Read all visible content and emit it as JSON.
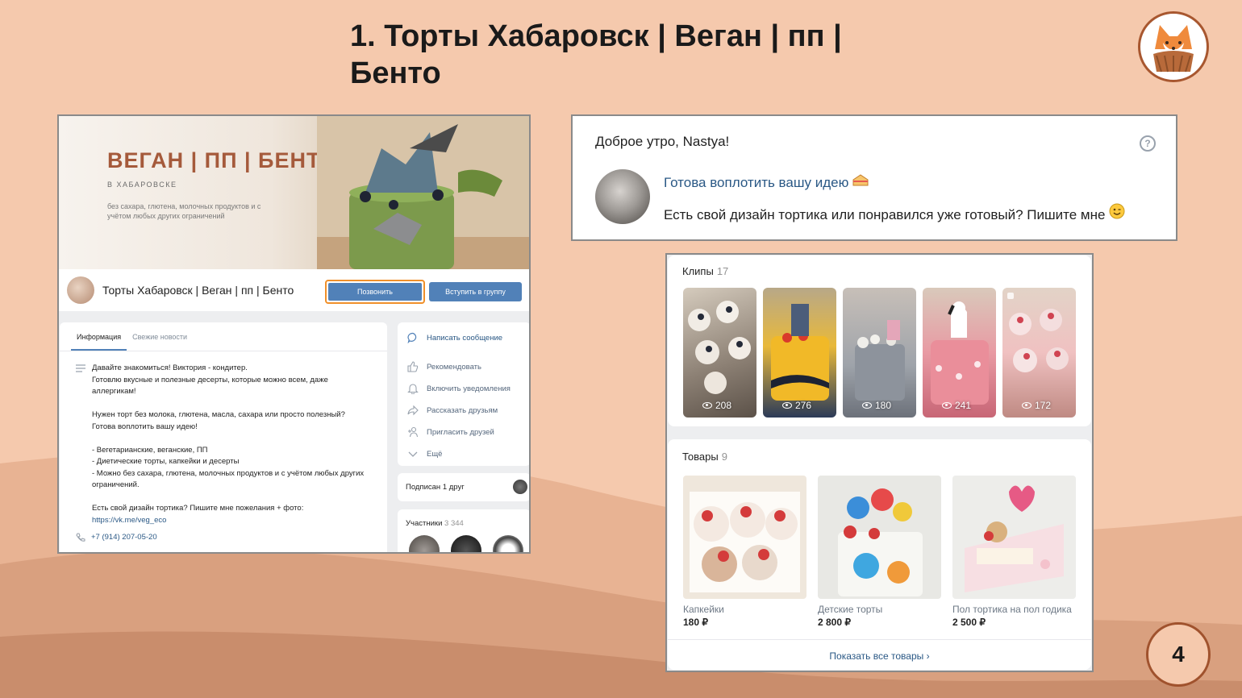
{
  "slide": {
    "title": "1. Торты Хабаровск | Веган | пп | Бенто",
    "page_number": "4"
  },
  "group_page": {
    "cover": {
      "title": "ВЕГАН | ПП | БЕНТО",
      "subtitle": "В ХАБАРОВСКЕ",
      "description": "без сахара, глютена, молочных продуктов и с учётом любых других ограничений"
    },
    "name": "Торты Хабаровск | Веган | пп | Бенто",
    "call_button": "Позвонить",
    "join_button": "Вступить в группу",
    "tabs": [
      "Информация",
      "Свежие новости"
    ],
    "info_text": "Давайте знакомиться! Виктория - кондитер.\nГотовлю вкусные и полезные десерты, которые можно всем, даже аллергикам!\n\nНужен торт без молока, глютена, масла, сахара или просто полезный?\nГотова воплотить вашу идею!\n\n- Вегетарианские, веганские, ПП\n- Диетические торты, капкейки и десерты\n- Можно без сахара, глютена, молочных продуктов и с учётом любых других ограничений.\n\nЕсть свой дизайн тортика? Пишите мне пожелания + фото:",
    "info_link": "https://vk.me/veg_eco",
    "phone": "+7 (914) 207-05-20",
    "actions": {
      "message": "Написать сообщение",
      "recommend": "Рекомендовать",
      "notify": "Включить уведомления",
      "share": "Рассказать друзьям",
      "invite": "Пригласить друзей",
      "more": "Ещё"
    },
    "subscribed": "Подписан 1 друг",
    "members_label": "Участники",
    "members_count": "3 344"
  },
  "greeting": {
    "text": "Доброе утро, Nastya!",
    "help": "?",
    "post_link": "Готова воплотить вашу идею",
    "post_text": "Есть свой дизайн тортика или понравился уже готовый? Пишите мне"
  },
  "clips": {
    "title": "Клипы",
    "count": "17",
    "items": [
      {
        "views": "208"
      },
      {
        "views": "276"
      },
      {
        "views": "180"
      },
      {
        "views": "241"
      },
      {
        "views": "172"
      }
    ]
  },
  "goods": {
    "title": "Товары",
    "count": "9",
    "items": [
      {
        "name": "Капкейки",
        "price": "180 ₽"
      },
      {
        "name": "Детские торты",
        "price": "2 800 ₽"
      },
      {
        "name": "Пол тортика на пол годика",
        "price": "2 500 ₽"
      }
    ],
    "show_all": "Показать все товары ›"
  },
  "colors": {
    "background": "#f5c9ad",
    "vk_blue": "#5181b8",
    "link": "#2a5885",
    "highlight": "#f0902a"
  }
}
